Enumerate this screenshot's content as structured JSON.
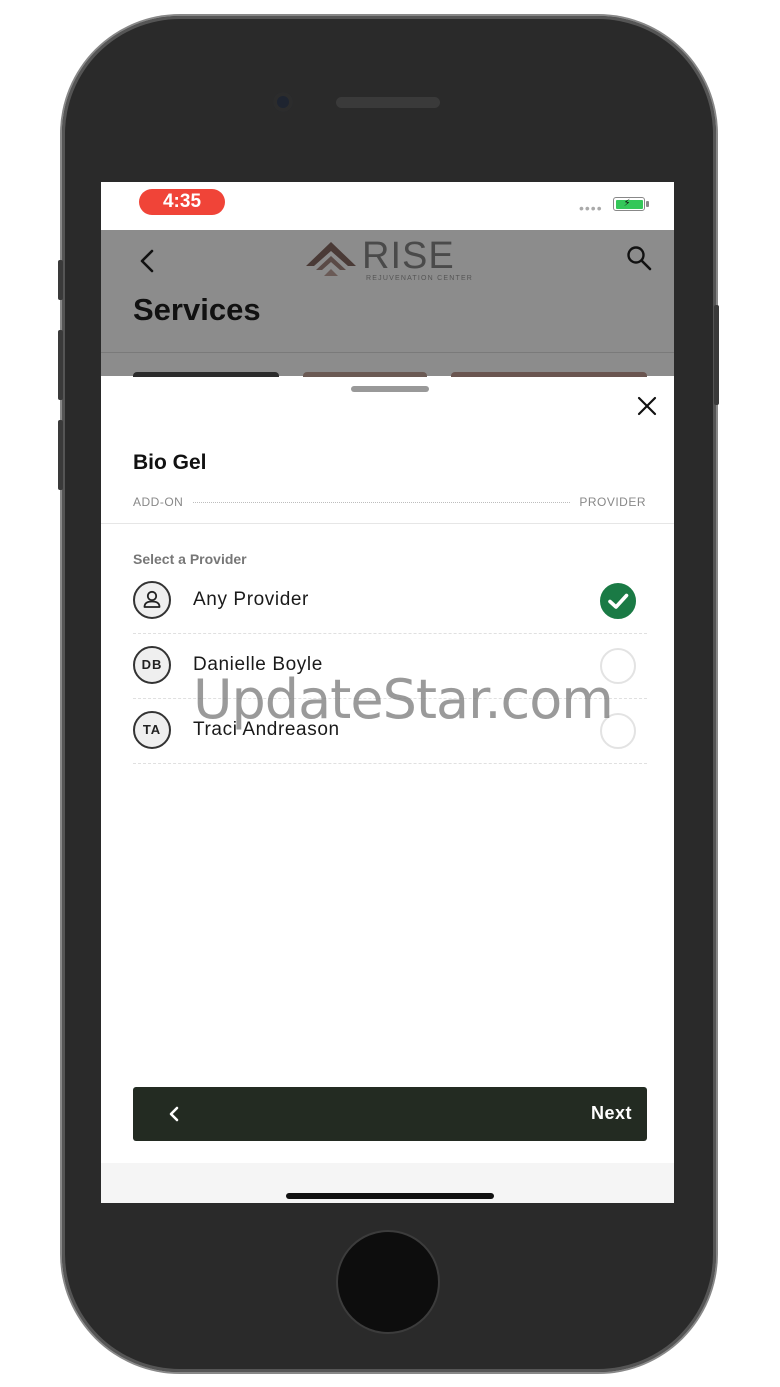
{
  "statusbar": {
    "time": "4:35",
    "signal_dots": "••••"
  },
  "header": {
    "logo_text": "RISE",
    "logo_subtext": "REJUVENATION CENTER",
    "title": "Services",
    "back_icon": "chevron-left-icon",
    "search_icon": "search-icon"
  },
  "sheet": {
    "title": "Bio Gel",
    "steps": {
      "left": "ADD-ON",
      "right": "PROVIDER"
    },
    "select_label": "Select a Provider",
    "close_icon": "close-icon",
    "providers": [
      {
        "initials": "",
        "icon": "person-icon",
        "name": "Any Provider",
        "selected": true
      },
      {
        "initials": "DB",
        "name": "Danielle Boyle",
        "selected": false
      },
      {
        "initials": "TA",
        "name": "Traci Andreason",
        "selected": false
      }
    ],
    "footer": {
      "back_icon": "chevron-left-icon",
      "next_label": "Next"
    }
  },
  "watermark": "UpdateStar.com",
  "colors": {
    "accent_green": "#1a7a45",
    "footer_bar": "#232b22",
    "time_pill": "#f04438",
    "header_overlay": "#8c8c8c"
  }
}
